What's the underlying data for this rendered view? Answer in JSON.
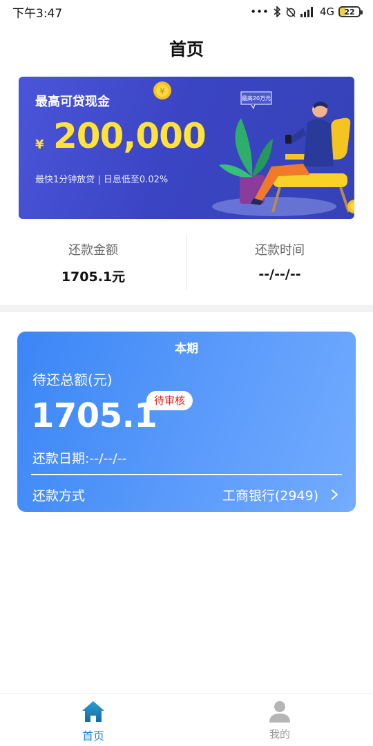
{
  "status_bar": {
    "time": "下午3:47",
    "network": "4G",
    "battery": "22"
  },
  "header": {
    "title": "首页"
  },
  "banner": {
    "title": "最高可贷现金",
    "currency": "¥",
    "amount": "200,000",
    "subtitle": "最快1分钟放贷 | 日息低至0.02%",
    "bubble": "最高20万元",
    "coin_symbol": "¥"
  },
  "summary": {
    "amount_label": "还款金额",
    "amount_value": "1705.1元",
    "time_label": "还款时间",
    "time_value": "--/--/--"
  },
  "bill_card": {
    "period": "本期",
    "total_label": "待还总额(元)",
    "total_value": "1705.1",
    "status_badge": "待审核",
    "due_date": "还款日期:--/--/--",
    "method_label": "还款方式",
    "bank": "工商银行(2949)"
  },
  "bottom_nav": {
    "items": [
      {
        "label": "首页",
        "icon": "home-icon",
        "active": true
      },
      {
        "label": "我的",
        "icon": "user-icon",
        "active": false
      }
    ]
  },
  "colors": {
    "banner_bg": "#3b45c4",
    "amount_yellow": "#ffe23a",
    "card_blue": "#3b86f6",
    "badge_red": "#d81e1e",
    "nav_active": "#1f88c9"
  }
}
